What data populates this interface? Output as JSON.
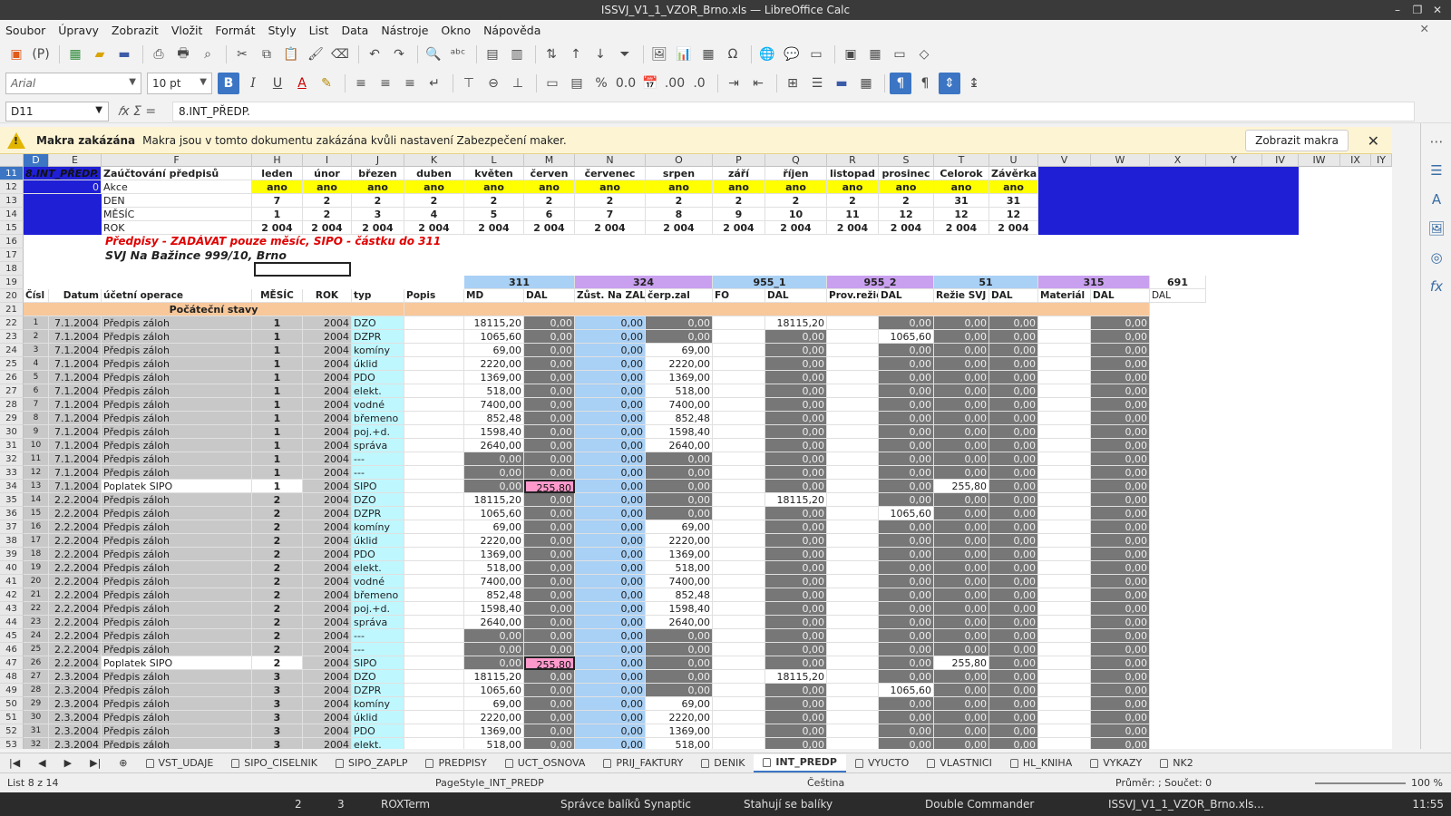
{
  "window": {
    "title": "ISSVJ_V1_1_VZOR_Brno.xls — LibreOffice Calc"
  },
  "menu": [
    "Soubor",
    "Úpravy",
    "Zobrazit",
    "Vložit",
    "Formát",
    "Styly",
    "List",
    "Data",
    "Nástroje",
    "Okno",
    "Nápověda"
  ],
  "toolbar": {
    "font_name": "Arial",
    "font_size": "10 pt"
  },
  "formula": {
    "cell_ref": "D11",
    "content": "8.INT_PŘEDP."
  },
  "macro_bar": {
    "title": "Makra zakázána",
    "message": "Makra jsou v tomto dokumentu zakázána kvůli nastavení Zabezpečení maker.",
    "button": "Zobrazit makra"
  },
  "columns": [
    "D",
    "E",
    "F",
    "H",
    "I",
    "J",
    "K",
    "L",
    "M",
    "N",
    "O",
    "P",
    "Q",
    "R",
    "S",
    "T",
    "U",
    "V",
    "W",
    "X",
    "Y",
    "IV",
    "IW",
    "IX",
    "IY"
  ],
  "header_block": {
    "title": "8.INT_PŘEDP.",
    "label": "Zaúčtování předpisů",
    "zero": "0",
    "rows": [
      "Akce",
      "DEN",
      "MĚSÍC",
      "ROK"
    ],
    "months": [
      "leden",
      "únor",
      "březen",
      "duben",
      "květen",
      "červen",
      "červenec",
      "srpen",
      "září",
      "říjen",
      "listopad",
      "prosinec",
      "Celorok",
      "Závěrka"
    ],
    "akce": [
      "ano",
      "ano",
      "ano",
      "ano",
      "ano",
      "ano",
      "ano",
      "ano",
      "ano",
      "ano",
      "ano",
      "ano",
      "ano",
      "ano"
    ],
    "den": [
      "7",
      "2",
      "2",
      "2",
      "2",
      "2",
      "2",
      "2",
      "2",
      "2",
      "2",
      "2",
      "31",
      "31"
    ],
    "mesic": [
      "1",
      "2",
      "3",
      "4",
      "5",
      "6",
      "7",
      "8",
      "9",
      "10",
      "11",
      "12",
      "12",
      "12"
    ],
    "rok": [
      "2 004",
      "2 004",
      "2 004",
      "2 004",
      "2 004",
      "2 004",
      "2 004",
      "2 004",
      "2 004",
      "2 004",
      "2 004",
      "2 004",
      "2 004",
      "2 004"
    ]
  },
  "note": "Předpisy - ZADÁVAT pouze měsíc, SIPO - částku do 311",
  "org": "SVJ Na Bažince 999/10, Brno",
  "accounts": [
    "311",
    "324",
    "955_1",
    "955_2",
    "51",
    "315",
    "691"
  ],
  "subheads": {
    "cislo": "Čísl",
    "datum": "Datum",
    "operace": "účetní operace",
    "mesic": "MĚSÍC",
    "rok": "ROK",
    "typ": "typ",
    "popis": "Popis",
    "md": "MD",
    "dal": "DAL",
    "zust": "Zůst. Na ZAL",
    "cerp": "čerp.zal",
    "fo": "FO",
    "prov": "Prov.režie",
    "rezie": "Režie SVJ",
    "mat": "Materiál"
  },
  "pocatecni": "Počáteční stavy",
  "rows": [
    [
      "22",
      "1",
      "7.1.2004",
      "Předpis záloh",
      "1",
      "2004",
      "DZO",
      "18115,20",
      "0,00",
      "0,00",
      "0,00",
      "18115,20",
      "0,00",
      "0,00",
      "0,00"
    ],
    [
      "23",
      "2",
      "7.1.2004",
      "Předpis záloh",
      "1",
      "2004",
      "DZPR",
      "1065,60",
      "0,00",
      "0,00",
      "0,00",
      "0,00",
      "1065,60",
      "0,00",
      "0,00"
    ],
    [
      "24",
      "3",
      "7.1.2004",
      "Předpis záloh",
      "1",
      "2004",
      "komíny",
      "69,00",
      "0,00",
      "0,00",
      "69,00",
      "0,00",
      "0,00",
      "0,00",
      "0,00"
    ],
    [
      "25",
      "4",
      "7.1.2004",
      "Předpis záloh",
      "1",
      "2004",
      "úklid",
      "2220,00",
      "0,00",
      "0,00",
      "2220,00",
      "0,00",
      "0,00",
      "0,00",
      "0,00"
    ],
    [
      "26",
      "5",
      "7.1.2004",
      "Předpis záloh",
      "1",
      "2004",
      "PDO",
      "1369,00",
      "0,00",
      "0,00",
      "1369,00",
      "0,00",
      "0,00",
      "0,00",
      "0,00"
    ],
    [
      "27",
      "6",
      "7.1.2004",
      "Předpis záloh",
      "1",
      "2004",
      "elekt.",
      "518,00",
      "0,00",
      "0,00",
      "518,00",
      "0,00",
      "0,00",
      "0,00",
      "0,00"
    ],
    [
      "28",
      "7",
      "7.1.2004",
      "Předpis záloh",
      "1",
      "2004",
      "vodné",
      "7400,00",
      "0,00",
      "0,00",
      "7400,00",
      "0,00",
      "0,00",
      "0,00",
      "0,00"
    ],
    [
      "29",
      "8",
      "7.1.2004",
      "Předpis záloh",
      "1",
      "2004",
      "břemeno",
      "852,48",
      "0,00",
      "0,00",
      "852,48",
      "0,00",
      "0,00",
      "0,00",
      "0,00"
    ],
    [
      "30",
      "9",
      "7.1.2004",
      "Předpis záloh",
      "1",
      "2004",
      "poj.+d.",
      "1598,40",
      "0,00",
      "0,00",
      "1598,40",
      "0,00",
      "0,00",
      "0,00",
      "0,00"
    ],
    [
      "31",
      "10",
      "7.1.2004",
      "Předpis záloh",
      "1",
      "2004",
      "správa",
      "2640,00",
      "0,00",
      "0,00",
      "2640,00",
      "0,00",
      "0,00",
      "0,00",
      "0,00"
    ],
    [
      "32",
      "11",
      "7.1.2004",
      "Předpis záloh",
      "1",
      "2004",
      "---",
      "0,00",
      "0,00",
      "0,00",
      "0,00",
      "0,00",
      "0,00",
      "0,00",
      "0,00"
    ],
    [
      "33",
      "12",
      "7.1.2004",
      "Předpis záloh",
      "1",
      "2004",
      "---",
      "0,00",
      "0,00",
      "0,00",
      "0,00",
      "0,00",
      "0,00",
      "0,00",
      "0,00"
    ],
    [
      "34",
      "13",
      "7.1.2004",
      "Poplatek SIPO",
      "1",
      "2004",
      "SIPO",
      "0,00",
      "255,80",
      "0,00",
      "0,00",
      "0,00",
      "0,00",
      "255,80",
      "0,00"
    ],
    [
      "35",
      "14",
      "2.2.2004",
      "Předpis záloh",
      "2",
      "2004",
      "DZO",
      "18115,20",
      "0,00",
      "0,00",
      "0,00",
      "18115,20",
      "0,00",
      "0,00",
      "0,00"
    ],
    [
      "36",
      "15",
      "2.2.2004",
      "Předpis záloh",
      "2",
      "2004",
      "DZPR",
      "1065,60",
      "0,00",
      "0,00",
      "0,00",
      "0,00",
      "1065,60",
      "0,00",
      "0,00"
    ],
    [
      "37",
      "16",
      "2.2.2004",
      "Předpis záloh",
      "2",
      "2004",
      "komíny",
      "69,00",
      "0,00",
      "0,00",
      "69,00",
      "0,00",
      "0,00",
      "0,00",
      "0,00"
    ],
    [
      "38",
      "17",
      "2.2.2004",
      "Předpis záloh",
      "2",
      "2004",
      "úklid",
      "2220,00",
      "0,00",
      "0,00",
      "2220,00",
      "0,00",
      "0,00",
      "0,00",
      "0,00"
    ],
    [
      "39",
      "18",
      "2.2.2004",
      "Předpis záloh",
      "2",
      "2004",
      "PDO",
      "1369,00",
      "0,00",
      "0,00",
      "1369,00",
      "0,00",
      "0,00",
      "0,00",
      "0,00"
    ],
    [
      "40",
      "19",
      "2.2.2004",
      "Předpis záloh",
      "2",
      "2004",
      "elekt.",
      "518,00",
      "0,00",
      "0,00",
      "518,00",
      "0,00",
      "0,00",
      "0,00",
      "0,00"
    ],
    [
      "41",
      "20",
      "2.2.2004",
      "Předpis záloh",
      "2",
      "2004",
      "vodné",
      "7400,00",
      "0,00",
      "0,00",
      "7400,00",
      "0,00",
      "0,00",
      "0,00",
      "0,00"
    ],
    [
      "42",
      "21",
      "2.2.2004",
      "Předpis záloh",
      "2",
      "2004",
      "břemeno",
      "852,48",
      "0,00",
      "0,00",
      "852,48",
      "0,00",
      "0,00",
      "0,00",
      "0,00"
    ],
    [
      "43",
      "22",
      "2.2.2004",
      "Předpis záloh",
      "2",
      "2004",
      "poj.+d.",
      "1598,40",
      "0,00",
      "0,00",
      "1598,40",
      "0,00",
      "0,00",
      "0,00",
      "0,00"
    ],
    [
      "44",
      "23",
      "2.2.2004",
      "Předpis záloh",
      "2",
      "2004",
      "správa",
      "2640,00",
      "0,00",
      "0,00",
      "2640,00",
      "0,00",
      "0,00",
      "0,00",
      "0,00"
    ],
    [
      "45",
      "24",
      "2.2.2004",
      "Předpis záloh",
      "2",
      "2004",
      "---",
      "0,00",
      "0,00",
      "0,00",
      "0,00",
      "0,00",
      "0,00",
      "0,00",
      "0,00"
    ],
    [
      "46",
      "25",
      "2.2.2004",
      "Předpis záloh",
      "2",
      "2004",
      "---",
      "0,00",
      "0,00",
      "0,00",
      "0,00",
      "0,00",
      "0,00",
      "0,00",
      "0,00"
    ],
    [
      "47",
      "26",
      "2.2.2004",
      "Poplatek SIPO",
      "2",
      "2004",
      "SIPO",
      "0,00",
      "255,80",
      "0,00",
      "0,00",
      "0,00",
      "0,00",
      "255,80",
      "0,00"
    ],
    [
      "48",
      "27",
      "2.3.2004",
      "Předpis záloh",
      "3",
      "2004",
      "DZO",
      "18115,20",
      "0,00",
      "0,00",
      "0,00",
      "18115,20",
      "0,00",
      "0,00",
      "0,00"
    ],
    [
      "49",
      "28",
      "2.3.2004",
      "Předpis záloh",
      "3",
      "2004",
      "DZPR",
      "1065,60",
      "0,00",
      "0,00",
      "0,00",
      "0,00",
      "1065,60",
      "0,00",
      "0,00"
    ],
    [
      "50",
      "29",
      "2.3.2004",
      "Předpis záloh",
      "3",
      "2004",
      "komíny",
      "69,00",
      "0,00",
      "0,00",
      "69,00",
      "0,00",
      "0,00",
      "0,00",
      "0,00"
    ],
    [
      "51",
      "30",
      "2.3.2004",
      "Předpis záloh",
      "3",
      "2004",
      "úklid",
      "2220,00",
      "0,00",
      "0,00",
      "2220,00",
      "0,00",
      "0,00",
      "0,00",
      "0,00"
    ],
    [
      "52",
      "31",
      "2.3.2004",
      "Předpis záloh",
      "3",
      "2004",
      "PDO",
      "1369,00",
      "0,00",
      "0,00",
      "1369,00",
      "0,00",
      "0,00",
      "0,00",
      "0,00"
    ],
    [
      "53",
      "32",
      "2.3.2004",
      "Předpis záloh",
      "3",
      "2004",
      "elekt.",
      "518,00",
      "0,00",
      "0,00",
      "518,00",
      "0,00",
      "0,00",
      "0,00",
      "0,00"
    ]
  ],
  "sheets": [
    "VST_UDAJE",
    "SIPO_CISELNIK",
    "SIPO_ZAPLP",
    "PREDPISY",
    "UCT_OSNOVA",
    "PRIJ_FAKTURY",
    "DENIK",
    "INT_PREDP",
    "VYUCTO",
    "VLASTNICI",
    "HL_KNIHA",
    "VYKAZY",
    "NK2"
  ],
  "status": {
    "sheet": "List 8 z 14",
    "style": "PageStyle_INT_PREDP",
    "lang": "Čeština",
    "sum": "Průměr: ; Součet: 0",
    "zoom": "100 %"
  },
  "taskbar": {
    "items": [
      "2",
      "3",
      "ROXTerm",
      "Správce balíků Synaptic",
      "Stahují se balíky",
      "Double Commander",
      "ISSVJ_V1_1_VZOR_Brno.xls..."
    ],
    "clock": "11:55"
  }
}
